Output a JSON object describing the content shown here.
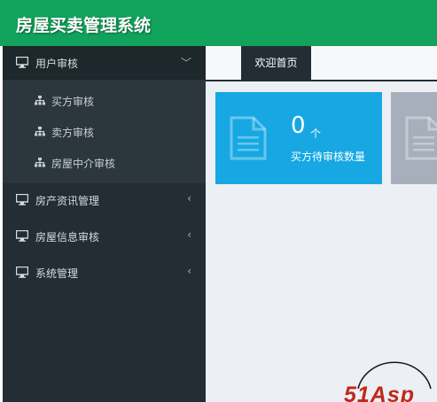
{
  "header": {
    "title": "房屋买卖管理系统"
  },
  "sidebar": {
    "items": [
      {
        "label": "用户审核",
        "icon": "monitor-icon",
        "expanded": true,
        "arrow": "﹀"
      },
      {
        "label": "房产资讯管理",
        "icon": "monitor-icon",
        "arrow": "‹"
      },
      {
        "label": "房屋信息审核",
        "icon": "monitor-icon",
        "arrow": "‹"
      },
      {
        "label": "系统管理",
        "icon": "monitor-icon",
        "arrow": "‹"
      }
    ],
    "subitems": [
      {
        "label": "买方审核",
        "icon": "sitemap-icon"
      },
      {
        "label": "卖方审核",
        "icon": "sitemap-icon"
      },
      {
        "label": "房屋中介审核",
        "icon": "sitemap-icon"
      }
    ]
  },
  "tabs": [
    {
      "label": "欢迎首页",
      "active": true
    }
  ],
  "cards": [
    {
      "count": "0",
      "unit": "个",
      "label": "买方待审核数量",
      "color": "#17a8e3",
      "icon": "document-icon"
    },
    {
      "color": "#a7afbc",
      "icon": "document-icon"
    }
  ],
  "watermark": {
    "text": "51Asp"
  },
  "colors": {
    "header": "#11a35b",
    "sidebar": "#232d33",
    "content": "#eceff3"
  }
}
